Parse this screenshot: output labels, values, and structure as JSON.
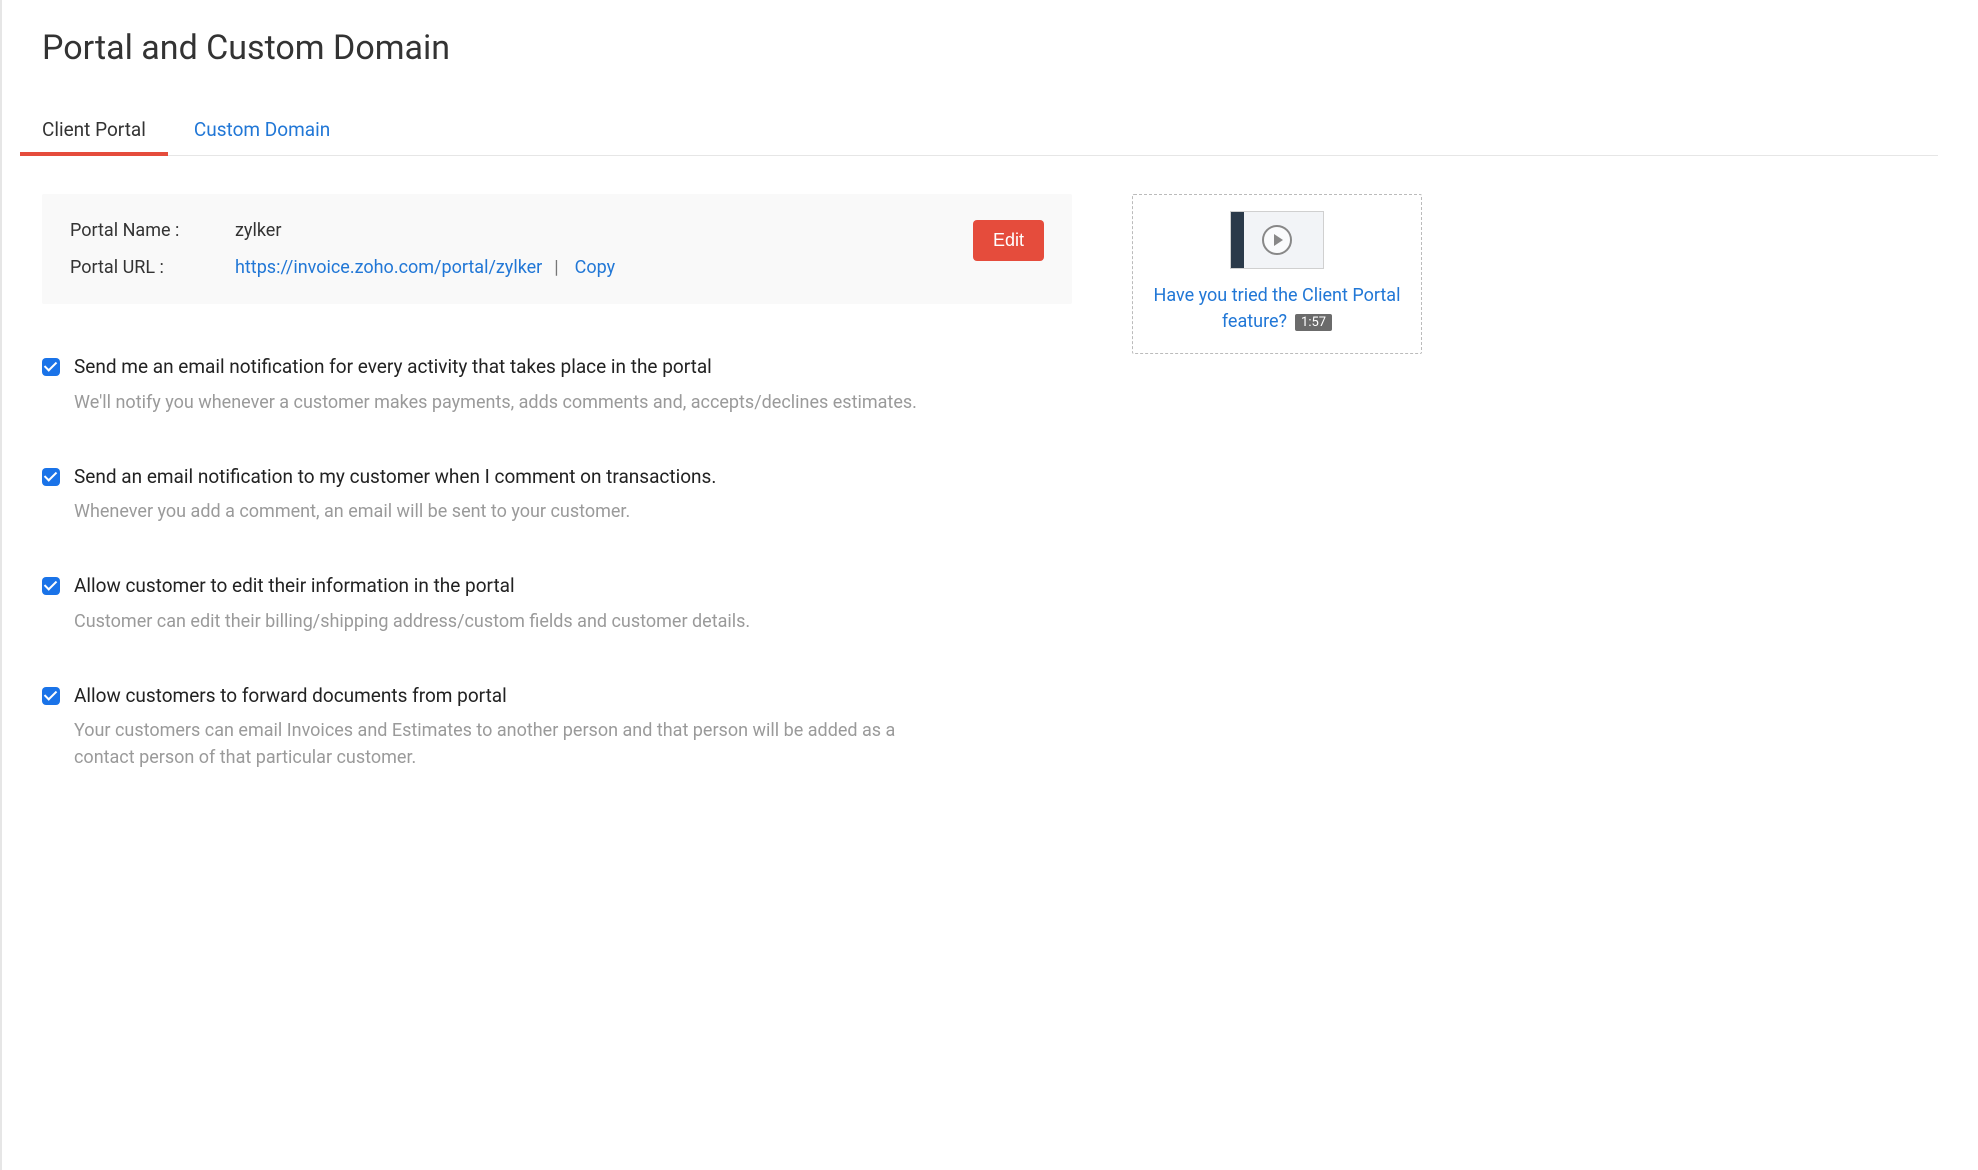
{
  "page": {
    "title": "Portal and Custom Domain"
  },
  "tabs": {
    "client_portal": "Client Portal",
    "custom_domain": "Custom Domain"
  },
  "portal": {
    "name_label": "Portal Name :",
    "name_value": "zylker",
    "url_label": "Portal URL :",
    "url_value": "https://invoice.zoho.com/portal/zylker",
    "separator": "|",
    "copy_label": "Copy",
    "edit_label": "Edit"
  },
  "settings": [
    {
      "title": "Send me an email notification for every activity that takes place in the portal",
      "desc": "We'll notify you whenever a customer makes payments, adds comments and, accepts/declines estimates."
    },
    {
      "title": "Send an email notification to my customer when I comment on transactions.",
      "desc": "Whenever you add a comment, an email will be sent to your customer."
    },
    {
      "title": "Allow customer to edit their information in the portal",
      "desc": "Customer can edit their billing/shipping address/custom fields and customer details."
    },
    {
      "title": "Allow customers to forward documents from portal",
      "desc": "Your customers can email Invoices and Estimates to another person and that person will be added as a contact person of that particular customer."
    }
  ],
  "video": {
    "caption": "Have you tried the Client Portal feature?",
    "time": "1:57"
  }
}
